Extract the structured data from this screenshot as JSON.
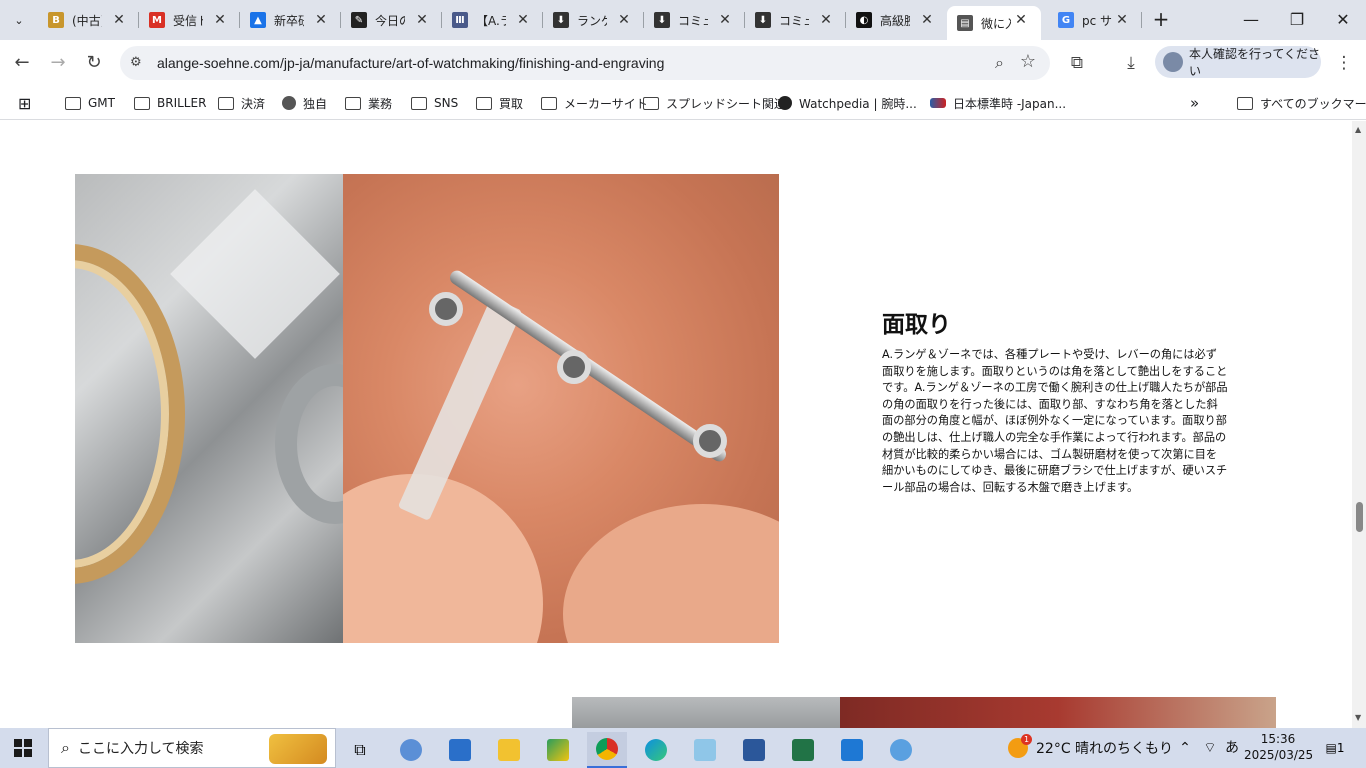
{
  "browser": {
    "tabs": [
      {
        "title": "(中古)",
        "favicon": "B",
        "color": "#c8962c"
      },
      {
        "title": "受信トレイ",
        "favicon": "M",
        "color": "#d93025"
      },
      {
        "title": "新卒研修",
        "favicon": "▲",
        "color": "#1a73e8"
      },
      {
        "title": "今日の",
        "favicon": "✎",
        "color": "#222"
      },
      {
        "title": "【A.ラン",
        "favicon": "Ⅲ",
        "color": "#4a5a8a"
      },
      {
        "title": "ランゲ",
        "favicon": "⬇",
        "color": "#333"
      },
      {
        "title": "コミュ",
        "favicon": "⬇",
        "color": "#333"
      },
      {
        "title": "コミュ",
        "favicon": "⬇",
        "color": "#333"
      },
      {
        "title": "高級腕",
        "favicon": "◐",
        "color": "#111"
      },
      {
        "title": "微に入",
        "favicon": "▤",
        "color": "#555"
      },
      {
        "title": "pc サ",
        "favicon": "G",
        "color": "#4285f4"
      }
    ],
    "active_tab_index": 9,
    "url": "alange-soehne.com/jp-ja/manufacture/art-of-watchmaking/finishing-and-engraving",
    "profile_label": "本人確認を行ってください"
  },
  "bookmarks": {
    "items": [
      {
        "label": "GMT",
        "type": "folder"
      },
      {
        "label": "BRILLER",
        "type": "folder"
      },
      {
        "label": "決済",
        "type": "folder"
      },
      {
        "label": "独自",
        "type": "globe"
      },
      {
        "label": "業務",
        "type": "folder"
      },
      {
        "label": "SNS",
        "type": "folder"
      },
      {
        "label": "買取",
        "type": "folder"
      },
      {
        "label": "メーカーサイト",
        "type": "folder"
      },
      {
        "label": "スプレッドシート関連",
        "type": "folder"
      },
      {
        "label": "Watchpedia | 腕時...",
        "type": "dark"
      },
      {
        "label": "日本標準時 -Japan...",
        "type": "logo"
      }
    ],
    "overflow": "»",
    "all_bookmarks": "すべてのブックマーク"
  },
  "page": {
    "section_title": "面取り",
    "section_body": "A.ランゲ＆ゾーネでは、各種プレートや受け、レバーの角には必ず面取りを施します。面取りというのは角を落として艶出しをすることです。A.ランゲ＆ゾーネの工房で働く腕利きの仕上げ職人たちが部品の角の面取りを行った後には、面取り部、すなわち角を落とした斜面の部分の角度と幅が、ほぼ例外なく一定になっています。面取り部の艶出しは、仕上げ職人の完全な手作業によって行われます。部品の材質が比較的柔らかい場合には、ゴム製研磨材を使って次第に目を細かいものにしてゆき、最後に研磨ブラシで仕上げますが、硬いスチール部品の場合は、回転する木盤で磨き上げます。"
  },
  "taskbar": {
    "search_placeholder": "ここに入力して検索",
    "weather": "22°C  晴れのちくもり",
    "weather_badge": "1",
    "ime": "あ",
    "time": "15:36",
    "date": "2025/03/25",
    "notifications": "1"
  }
}
